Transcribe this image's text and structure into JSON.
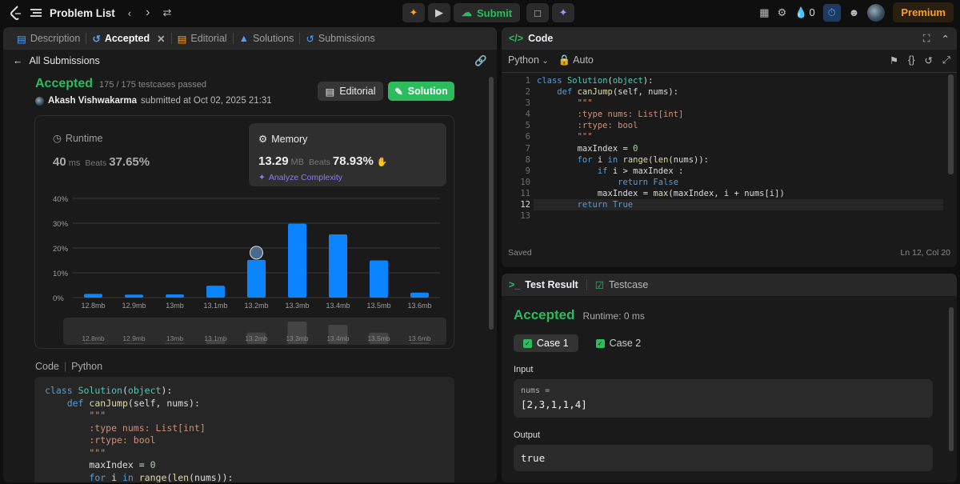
{
  "topbar": {
    "title": "Problem List",
    "submit_label": "Submit",
    "streak_count": "0",
    "premium_label": "Premium"
  },
  "left_tabs": [
    {
      "label": "Description"
    },
    {
      "label": "Accepted"
    },
    {
      "label": "Editorial"
    },
    {
      "label": "Solutions"
    },
    {
      "label": "Submissions"
    }
  ],
  "submission": {
    "back_label": "All Submissions",
    "status": "Accepted",
    "testcases": "175 / 175 testcases passed",
    "user": "Akash Vishwakarma",
    "submitted_text": "submitted at Oct 02, 2025 21:31",
    "editorial_btn": "Editorial",
    "solution_btn": "Solution",
    "runtime_label": "Runtime",
    "runtime_value": "40",
    "runtime_unit": "ms",
    "runtime_beats_label": "Beats",
    "runtime_beats": "37.65%",
    "memory_label": "Memory",
    "memory_value": "13.29",
    "memory_unit": "MB",
    "memory_beats_label": "Beats",
    "memory_beats": "78.93%",
    "analyze_label": "Analyze Complexity",
    "code_label": "Code",
    "lang_label": "Python"
  },
  "chart_data": {
    "type": "bar",
    "categories": [
      "12.8mb",
      "12.9mb",
      "13mb",
      "13.1mb",
      "13.2mb",
      "13.3mb",
      "13.4mb",
      "13.5mb",
      "13.6mb"
    ],
    "values": [
      1.5,
      1.2,
      1.3,
      4.8,
      15.2,
      29.8,
      25.5,
      15.0,
      2.0
    ],
    "yticks": [
      "0%",
      "10%",
      "20%",
      "30%",
      "40%"
    ],
    "ylim": [
      0,
      40
    ],
    "highlight_index": 4,
    "bar_color": "#0a84ff",
    "grid": true
  },
  "editor": {
    "title": "Code",
    "language": "Python",
    "mode": "Auto",
    "saved": "Saved",
    "cursor": "Ln 12, Col 20",
    "line_numbers": [
      "1",
      "2",
      "3",
      "4",
      "5",
      "6",
      "7",
      "8",
      "9",
      "10",
      "11",
      "12",
      "13"
    ]
  },
  "result": {
    "tab_result": "Test Result",
    "tab_testcase": "Testcase",
    "status": "Accepted",
    "runtime": "Runtime: 0 ms",
    "case1": "Case 1",
    "case2": "Case 2",
    "input_label": "Input",
    "input_name": "nums =",
    "input_value": "[2,3,1,1,4]",
    "output_label": "Output",
    "output_value": "true"
  }
}
